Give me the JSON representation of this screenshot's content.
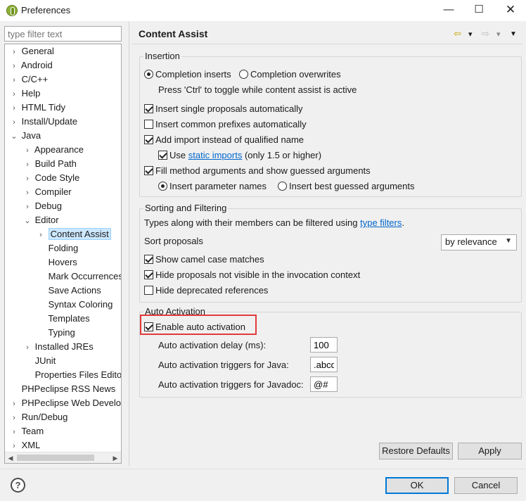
{
  "window": {
    "title": "Preferences"
  },
  "filter": {
    "placeholder": "type filter text"
  },
  "tree": [
    {
      "label": "General",
      "twisty": "›"
    },
    {
      "label": "Android",
      "twisty": "›"
    },
    {
      "label": "C/C++",
      "twisty": "›"
    },
    {
      "label": "Help",
      "twisty": "›"
    },
    {
      "label": "HTML Tidy",
      "twisty": "›"
    },
    {
      "label": "Install/Update",
      "twisty": "›"
    },
    {
      "label": "Java",
      "twisty": "⌄"
    },
    {
      "label": "Appearance",
      "twisty": "›"
    },
    {
      "label": "Build Path",
      "twisty": "›"
    },
    {
      "label": "Code Style",
      "twisty": "›"
    },
    {
      "label": "Compiler",
      "twisty": "›"
    },
    {
      "label": "Debug",
      "twisty": "›"
    },
    {
      "label": "Editor",
      "twisty": "⌄"
    },
    {
      "label": "Content Assist",
      "twisty": "›"
    },
    {
      "label": "Folding",
      "twisty": ""
    },
    {
      "label": "Hovers",
      "twisty": ""
    },
    {
      "label": "Mark Occurrences",
      "twisty": ""
    },
    {
      "label": "Save Actions",
      "twisty": ""
    },
    {
      "label": "Syntax Coloring",
      "twisty": ""
    },
    {
      "label": "Templates",
      "twisty": ""
    },
    {
      "label": "Typing",
      "twisty": ""
    },
    {
      "label": "Installed JREs",
      "twisty": "›"
    },
    {
      "label": "JUnit",
      "twisty": ""
    },
    {
      "label": "Properties Files Editor",
      "twisty": ""
    },
    {
      "label": "PHPeclipse RSS News",
      "twisty": ""
    },
    {
      "label": "PHPeclipse Web Development",
      "twisty": "›"
    },
    {
      "label": "Run/Debug",
      "twisty": "›"
    },
    {
      "label": "Team",
      "twisty": "›"
    },
    {
      "label": "XML",
      "twisty": "›"
    }
  ],
  "page": {
    "title": "Content Assist"
  },
  "insertion": {
    "legend": "Insertion",
    "radio_completion_inserts": "Completion inserts",
    "radio_completion_overwrites": "Completion overwrites",
    "toggle_hint": "Press 'Ctrl' to toggle while content assist is active",
    "insert_single": "Insert single proposals automatically",
    "insert_common_prefixes": "Insert common prefixes automatically",
    "add_import": "Add import instead of qualified name",
    "use": "Use",
    "static_imports": "static imports",
    "only_15": "(only 1.5 or higher)",
    "fill_args": "Fill method arguments and show guessed arguments",
    "insert_param_names": "Insert parameter names",
    "insert_best_guessed": "Insert best guessed arguments"
  },
  "sorting": {
    "legend": "Sorting and Filtering",
    "types_text": "Types along with their members can be filtered using",
    "type_filters": "type filters",
    "period": ".",
    "sort_proposals": "Sort proposals",
    "sort_value": "by relevance",
    "show_camel": "Show camel case matches",
    "hide_not_visible": "Hide proposals not visible in the invocation context",
    "hide_deprecated": "Hide deprecated references"
  },
  "auto": {
    "legend": "Auto Activation",
    "enable": "Enable auto activation",
    "delay_label": "Auto activation delay (ms):",
    "delay_value": "100",
    "java_label": "Auto activation triggers for Java:",
    "java_value": ".abcd",
    "javadoc_label": "Auto activation triggers for Javadoc:",
    "javadoc_value": "@#"
  },
  "buttons": {
    "restore": "Restore Defaults",
    "apply": "Apply",
    "ok": "OK",
    "cancel": "Cancel",
    "help": "?"
  },
  "icons": {
    "back": "⇦",
    "forward": "⇨",
    "dropdown": "▾",
    "menu": "▼",
    "minimize": "—",
    "maximize": "☐",
    "close": "✕"
  }
}
